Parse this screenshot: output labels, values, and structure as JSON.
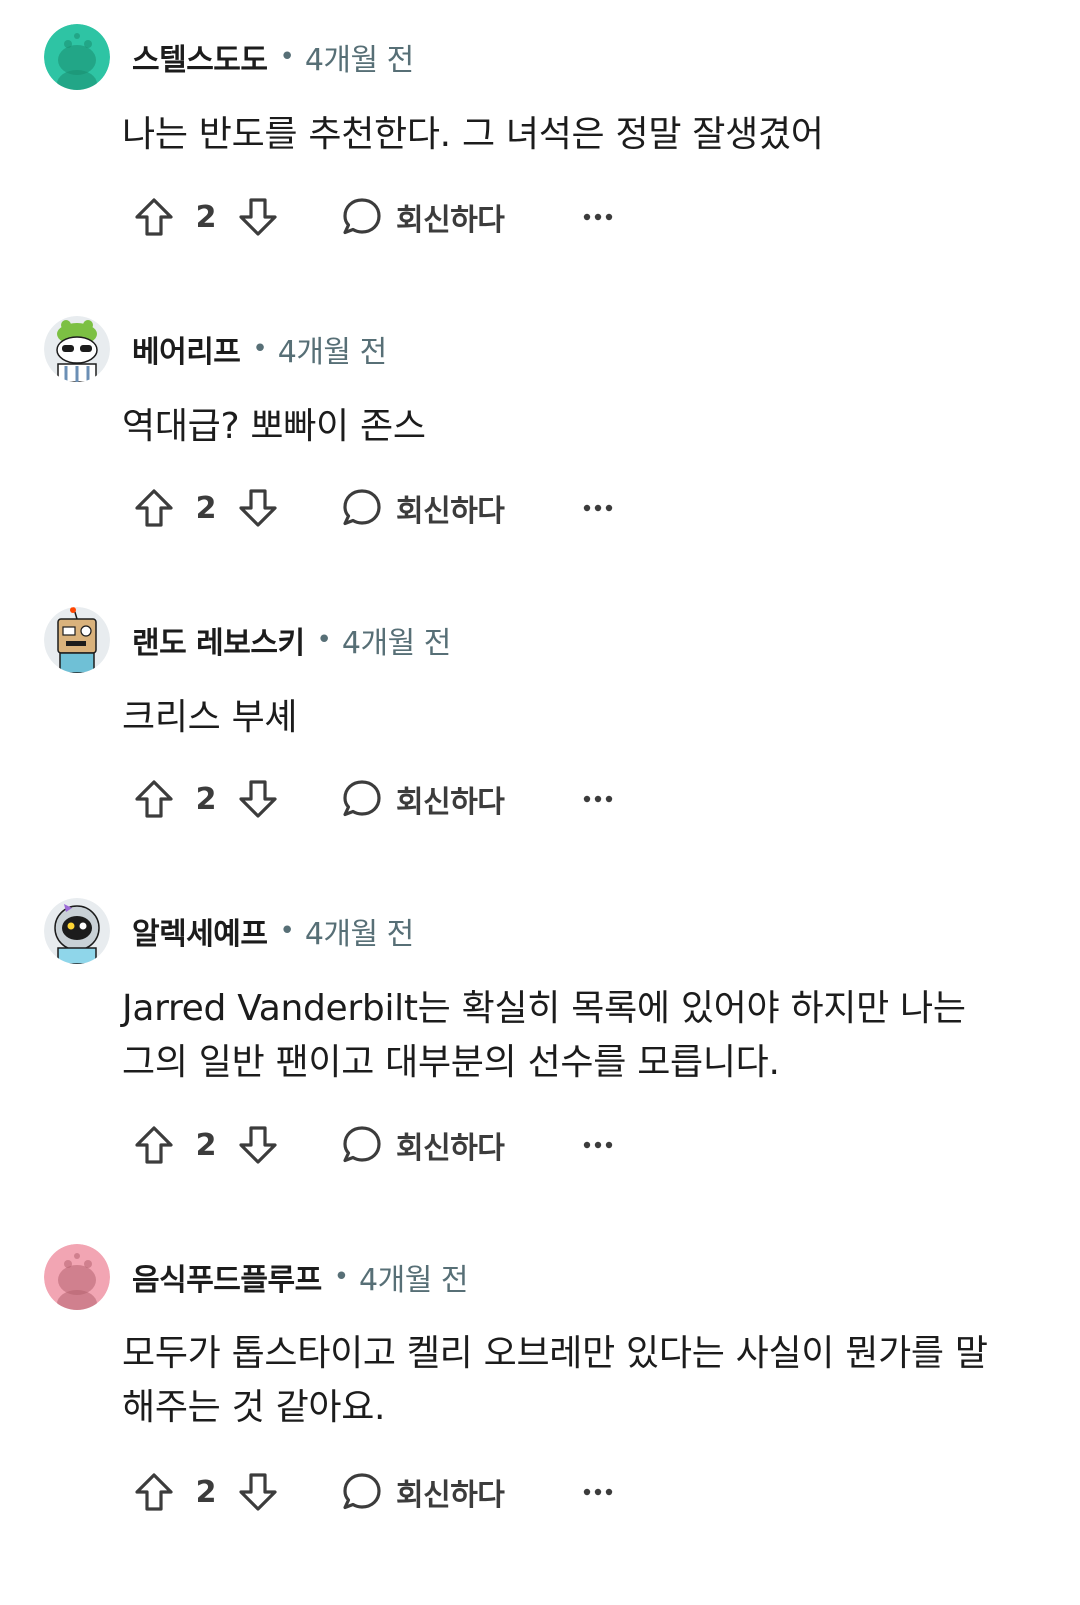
{
  "comments": [
    {
      "username": "스텔스도도",
      "separator": "•",
      "timestamp": "4개월 전",
      "body_lines": [
        "나는 반도를 추천한다. 그 녀석은 정말 잘생겼어"
      ],
      "votes": "2",
      "reply_label": "회신하다",
      "avatar_color": "#2ec4a4",
      "avatar_icon": "snoo-avatar-green"
    },
    {
      "username": "베어리프",
      "separator": "•",
      "timestamp": "4개월 전",
      "body_lines": [
        "역대급? 뽀빠이 존스"
      ],
      "votes": "2",
      "reply_label": "회신하다",
      "avatar_color": "#e8ecef",
      "avatar_icon": "snoo-avatar-frog-hat"
    },
    {
      "username": "랜도 레보스키",
      "separator": "•",
      "timestamp": "4개월 전",
      "body_lines": [
        "크리스 부셰"
      ],
      "votes": "2",
      "reply_label": "회신하다",
      "avatar_color": "#e8ecef",
      "avatar_icon": "snoo-avatar-box-robot"
    },
    {
      "username": "알렉세예프",
      "separator": "•",
      "timestamp": "4개월 전",
      "body_lines": [
        "Jarred Vanderbilt는 확실히 목록에 있어야 하지만 나는",
        "그의 일반 팬이고 대부분의 선수를 모릅니다."
      ],
      "votes": "2",
      "reply_label": "회신하다",
      "avatar_color": "#e8ecef",
      "avatar_icon": "snoo-avatar-astronaut"
    },
    {
      "username": "음식푸드플루프",
      "separator": "•",
      "timestamp": "4개월 전",
      "body_lines": [
        "모두가 톱스타이고 켈리 오브레만 있다는 사실이 뭔가를 말",
        "해주는 것 같아요."
      ],
      "votes": "2",
      "reply_label": "회신하다",
      "avatar_color": "#f2a5b3",
      "avatar_icon": "snoo-avatar-pink"
    }
  ],
  "colors": {
    "meta_gray": "#576f76",
    "action_gray": "#3c3c3c",
    "text": "#1c1c1c",
    "background": "#ffffff"
  }
}
